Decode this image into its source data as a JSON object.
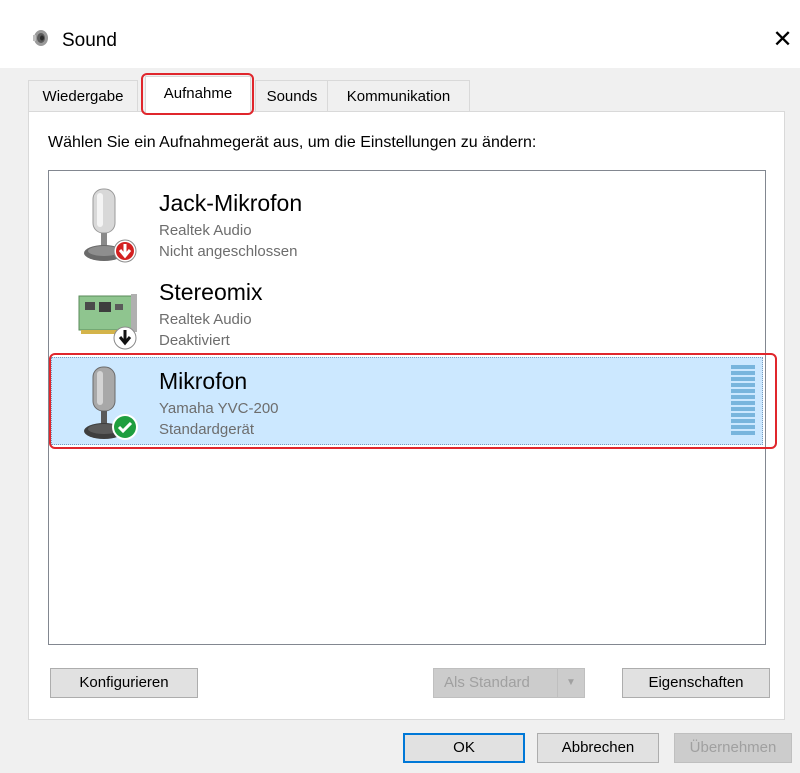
{
  "window": {
    "title": "Sound",
    "close_glyph": "✕",
    "icon": "speaker-icon"
  },
  "tabs": [
    {
      "label": "Wiedergabe",
      "active": false
    },
    {
      "label": "Aufnahme",
      "active": true
    },
    {
      "label": "Sounds",
      "active": false
    },
    {
      "label": "Kommunikation",
      "active": false
    }
  ],
  "instruction": "Wählen Sie ein Aufnahmegerät aus, um die Einstellungen zu ändern:",
  "devices": [
    {
      "name": "Jack-Mikrofon",
      "driver": "Realtek Audio",
      "status": "Nicht angeschlossen",
      "icon": "microphone-icon",
      "badge": "red-down-arrow"
    },
    {
      "name": "Stereomix",
      "driver": "Realtek Audio",
      "status": "Deaktiviert",
      "icon": "sound-card-icon",
      "badge": "black-down-arrow"
    },
    {
      "name": "Mikrofon",
      "driver": "Yamaha YVC-200",
      "status": "Standardgerät",
      "icon": "microphone-icon",
      "badge": "green-check",
      "selected": true
    }
  ],
  "buttons": {
    "configure": "Konfigurieren",
    "set_default": "Als Standard",
    "properties": "Eigenschaften",
    "ok": "OK",
    "cancel": "Abbrechen",
    "apply": "Übernehmen"
  },
  "colors": {
    "highlight": "#e0262c",
    "selection": "#cce8ff",
    "accent": "#0078d7"
  }
}
